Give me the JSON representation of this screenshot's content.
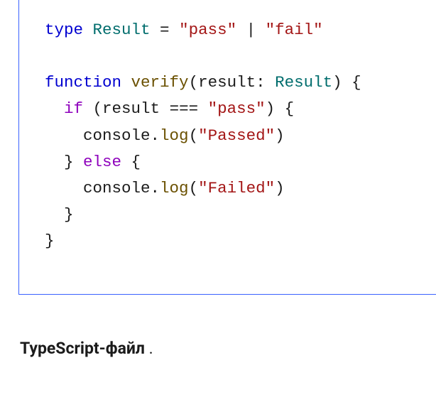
{
  "code": {
    "l1_kw_type": "type",
    "l1_type_name": "Result",
    "l1_eq": " = ",
    "l1_str_pass": "\"pass\"",
    "l1_pipe": " | ",
    "l1_str_fail": "\"fail\"",
    "l3_kw_function": "function",
    "l3_fn_name": "verify",
    "l3_paren_open": "(",
    "l3_param": "result",
    "l3_colon_sp": ": ",
    "l3_param_type": "Result",
    "l3_paren_close_brace": ") {",
    "l4_indent": "  ",
    "l4_if": "if",
    "l4_cond_open": " (result ",
    "l4_eqeqeq": "===",
    "l4_sp": " ",
    "l4_str_pass": "\"pass\"",
    "l4_cond_close": ") {",
    "l5_indent": "    ",
    "l5_console": "console",
    "l5_dot": ".",
    "l5_log": "log",
    "l5_open": "(",
    "l5_str": "\"Passed\"",
    "l5_close": ")",
    "l6_indent": "  ",
    "l6_close_brace": "} ",
    "l6_else": "else",
    "l6_open_brace": " {",
    "l7_indent": "    ",
    "l7_console": "console",
    "l7_dot": ".",
    "l7_log": "log",
    "l7_open": "(",
    "l7_str": "\"Failed\"",
    "l7_close": ")",
    "l8_indent": "  ",
    "l8_brace": "}",
    "l9_brace": "}"
  },
  "caption": {
    "strong": "TypeScript-файл",
    "trail": " ."
  }
}
